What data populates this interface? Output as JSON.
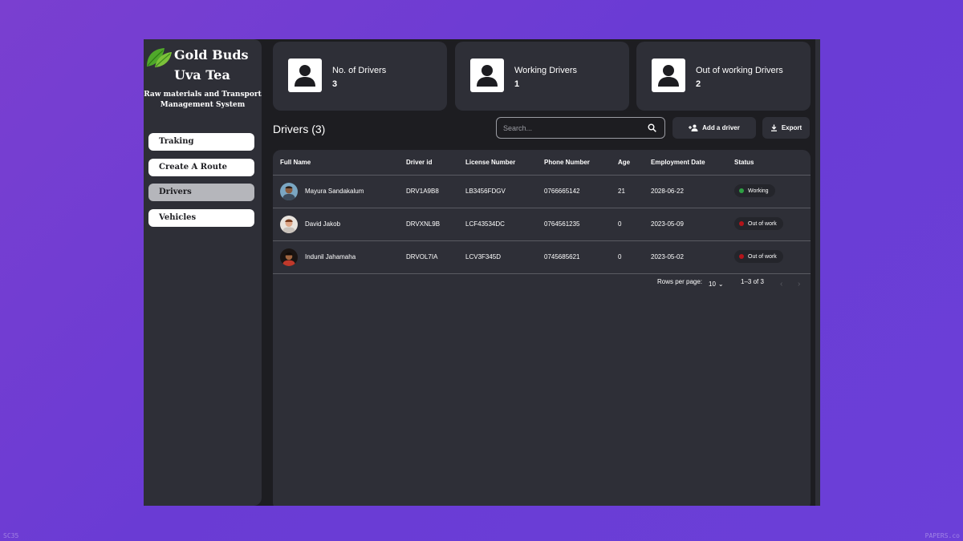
{
  "brand": {
    "line1": "Gold Buds",
    "line2": "Uva Tea",
    "subtitle_line1": "Raw materials and Transport",
    "subtitle_line2": "Management System"
  },
  "sidebar": {
    "items": [
      {
        "label": "Traking",
        "active": false
      },
      {
        "label": "Create A Route",
        "active": false
      },
      {
        "label": "Drivers",
        "active": true
      },
      {
        "label": "Vehicles",
        "active": false
      }
    ]
  },
  "stats": [
    {
      "label": "No. of Drivers",
      "value": "3",
      "icon": "user-icon"
    },
    {
      "label": "Working Drivers",
      "value": "1",
      "icon": "user-icon"
    },
    {
      "label": "Out of working Drivers",
      "value": "2",
      "icon": "user-icon"
    }
  ],
  "drivers": {
    "title": "Drivers (3)",
    "search_placeholder": "Search...",
    "add_label": "Add a driver",
    "export_label": "Export",
    "columns": [
      "Full Name",
      "Driver id",
      "License Number",
      "Phone Number",
      "Age",
      "Employment Date",
      "Status"
    ],
    "rows": [
      {
        "name": "Mayura Sandakalum",
        "id": "DRV1A9B8",
        "license": "LB3456FDGV",
        "phone": "0766665142",
        "age": "21",
        "date": "2028-06-22",
        "status": "Working",
        "status_color": "#2ea043"
      },
      {
        "name": "David Jakob",
        "id": "DRVXNL9B",
        "license": "LCF43534DC",
        "phone": "0764561235",
        "age": "0",
        "date": "2023-05-09",
        "status": "Out of work",
        "status_color": "#b3141a"
      },
      {
        "name": "Indunil Jahamaha",
        "id": "DRVOL7IA",
        "license": "LCV3F345D",
        "phone": "0745685621",
        "age": "0",
        "date": "2023-05-02",
        "status": "Out of work",
        "status_color": "#b3141a"
      }
    ],
    "pagination": {
      "rows_per_page_label": "Rows per page:",
      "rows_per_page": "10",
      "range": "1–3 of 3"
    }
  },
  "watermarks": {
    "left": "SC35",
    "right": "PAPERS.co"
  },
  "colors": {
    "panel": "#2e2f37",
    "background": "#1d1d21",
    "active_nav": "#b5b6bb",
    "working": "#2ea043",
    "out_of_work": "#b3141a"
  }
}
